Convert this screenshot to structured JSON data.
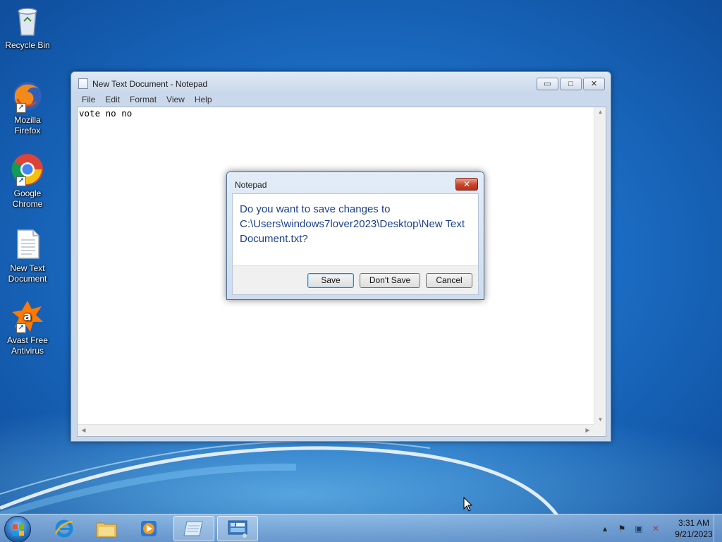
{
  "desktop": {
    "icons": [
      {
        "label": "Recycle Bin",
        "icon": "recycle-bin-icon"
      },
      {
        "label": "Mozilla Firefox",
        "icon": "firefox-icon"
      },
      {
        "label": "Google Chrome",
        "icon": "chrome-icon"
      },
      {
        "label": "New Text Document",
        "icon": "text-file-icon"
      },
      {
        "label": "Avast Free Antivirus",
        "icon": "avast-icon"
      }
    ]
  },
  "notepad": {
    "title": "New Text Document - Notepad",
    "menu": [
      "File",
      "Edit",
      "Format",
      "View",
      "Help"
    ],
    "content": "vote no no",
    "controls": {
      "minimize": "▭",
      "maximize": "□",
      "close": "✕"
    }
  },
  "dialog": {
    "title": "Notepad",
    "message": "Do you want to save changes to C:\\Users\\windows7lover2023\\Desktop\\New Text Document.txt?",
    "buttons": {
      "save": "Save",
      "dont_save": "Don't Save",
      "cancel": "Cancel"
    },
    "close_glyph": "✕"
  },
  "taskbar": {
    "items": [
      "start-orb",
      "internet-explorer-icon",
      "file-explorer-icon",
      "media-player-icon",
      "notepad-icon",
      "control-panel-icon"
    ],
    "clock": {
      "time": "3:31 AM",
      "date": "9/21/2023"
    },
    "tray_glyphs": {
      "show_hidden": "▴",
      "action_center": "⚑",
      "network": "▣",
      "volume": "✕"
    }
  },
  "colors": {
    "desktop_blue": "#1864bf",
    "dialog_text": "#1b3f8f",
    "close_red": "#c9442b"
  }
}
